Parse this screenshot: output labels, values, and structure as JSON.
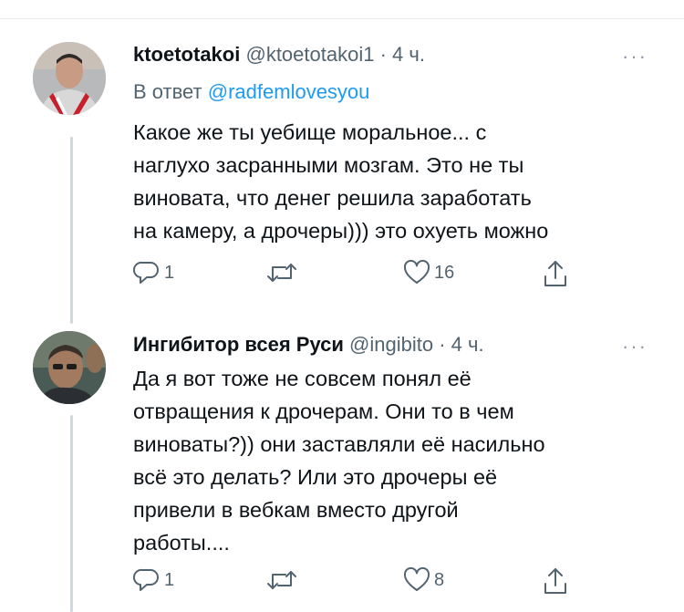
{
  "tweets": [
    {
      "name": "ktoetotakoi",
      "handle": "@ktoetotakoi1",
      "time": "4 ч.",
      "reply_prefix": "В ответ",
      "reply_handle": "@radfemlovesyou",
      "text_lines": [
        "Какое же ты уебище моральное... с",
        "наглухо засранными  мозгам. Это не ты",
        "виновата,  что денег решила заработать",
        "на камеру, а дрочеры))) это охуеть можно"
      ],
      "replies": "1",
      "likes": "16"
    },
    {
      "name": "Ингибитор всея Руси",
      "handle": "@ingibito",
      "time": "4 ч.",
      "text_lines": [
        "Да я вот тоже не совсем понял её",
        "отвращения к дрочерам. Они то в чем",
        "виноваты?)) они заставляли её насильно",
        "всё это делать? Или это дрочеры её",
        "привели в вебкам вместо другой",
        "работы...."
      ],
      "replies": "1",
      "likes": "8"
    }
  ],
  "ui": {
    "dot": "·",
    "more": "···"
  },
  "colors": {
    "link": "#1d9bf0",
    "secondary": "#536471",
    "divider": "#e6ecf0"
  }
}
